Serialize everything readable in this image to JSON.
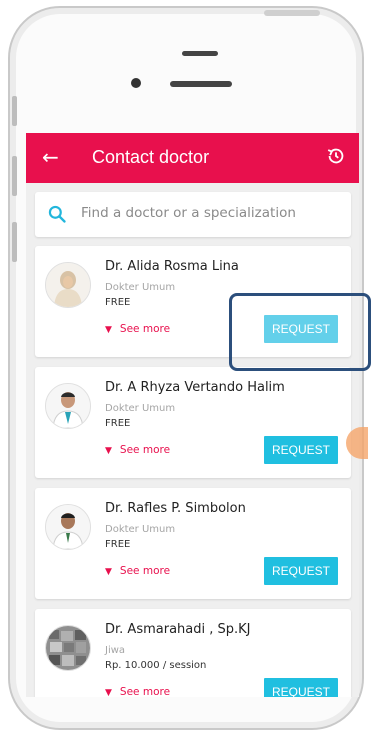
{
  "app": {
    "title": "Contact doctor",
    "back_icon": "arrow-left-icon",
    "history_icon": "history-icon",
    "brand_color": "#e8104d",
    "accent_color": "#20bfe0"
  },
  "search": {
    "placeholder": "Find a doctor or a specialization",
    "icon": "search-icon"
  },
  "doctors": [
    {
      "name": "Dr. Alida Rosma Lina",
      "specialization": "Dokter Umum",
      "price": "FREE",
      "see_more": "See more",
      "request_label": "REQUEST"
    },
    {
      "name": "Dr. A Rhyza Vertando Halim",
      "specialization": "Dokter Umum",
      "price": "FREE",
      "see_more": "See more",
      "request_label": "REQUEST"
    },
    {
      "name": "Dr. Rafles P. Simbolon",
      "specialization": "Dokter Umum",
      "price": "FREE",
      "see_more": "See more",
      "request_label": "REQUEST"
    },
    {
      "name": "Dr. Asmarahadi , Sp.KJ",
      "specialization": "Jiwa",
      "price": "Rp. 10.000 / session",
      "see_more": "See more",
      "request_label": "REQUEST"
    }
  ]
}
